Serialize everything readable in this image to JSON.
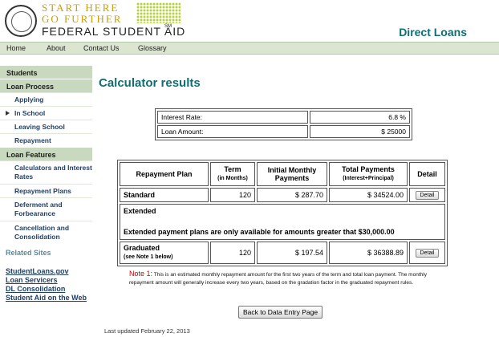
{
  "header": {
    "tagline_line1": "START HERE",
    "tagline_line2": "GO FURTHER",
    "org_name": "FEDERAL STUDENT AID",
    "trademark": "SM",
    "program": "Direct Loans"
  },
  "topnav": [
    "Home",
    "About",
    "Contact Us",
    "Glossary"
  ],
  "sidebar": {
    "students": "Students",
    "loan_process": "Loan Process",
    "process_items": [
      "Applying",
      "In School",
      "Leaving School",
      "Repayment"
    ],
    "loan_features": "Loan Features",
    "feature_items": [
      "Calculators and Interest Rates",
      "Repayment Plans",
      "Deferment and Forbearance",
      "Cancellation and Consolidation"
    ],
    "related_title": "Related Sites",
    "related_links": [
      "StudentLoans.gov",
      "Loan Servicers",
      "DL Consolidation",
      "Student Aid on the Web"
    ]
  },
  "main": {
    "title": "Calculator results",
    "inputs": {
      "interest_label": "Interest Rate:",
      "interest_value": "6.8 %",
      "amount_label": "Loan Amount:",
      "amount_value": "$ 25000"
    },
    "results": {
      "headers": {
        "plan": "Repayment Plan",
        "term": "Term",
        "term_sub": "(in Months)",
        "monthly": "Initial Monthly Payments",
        "total": "Total Payments",
        "total_sub": "(Interest+Principal)",
        "detail": "Detail"
      },
      "standard": {
        "plan": "Standard",
        "term": "120",
        "monthly": "$ 287.70",
        "total": "$ 34524.00",
        "detail": "Detail"
      },
      "extended": {
        "plan": "Extended",
        "message": "Extended payment plans are only available for amounts greater that $30,000.00"
      },
      "graduated": {
        "plan": "Graduated",
        "note": "(see Note 1 below)",
        "term": "120",
        "monthly": "$ 197.54",
        "total": "$ 36388.89",
        "detail": "Detail"
      }
    },
    "note": {
      "label": "Note 1:",
      "text": "This is an estimated monthly repayment amount for the first two years of the term and total loan payment. The monthly repayment amount will generally increase every two years, based on the gradation factor in the graduated repayment rules."
    },
    "back_button": "Back to Data Entry Page",
    "last_updated": "Last updated February 22, 2013"
  },
  "colors": {
    "accent": "#0f6e73",
    "nav_bg": "#dbe6d0",
    "sidebar_head": "#c9d9bf",
    "tagline": "#c9a000"
  }
}
